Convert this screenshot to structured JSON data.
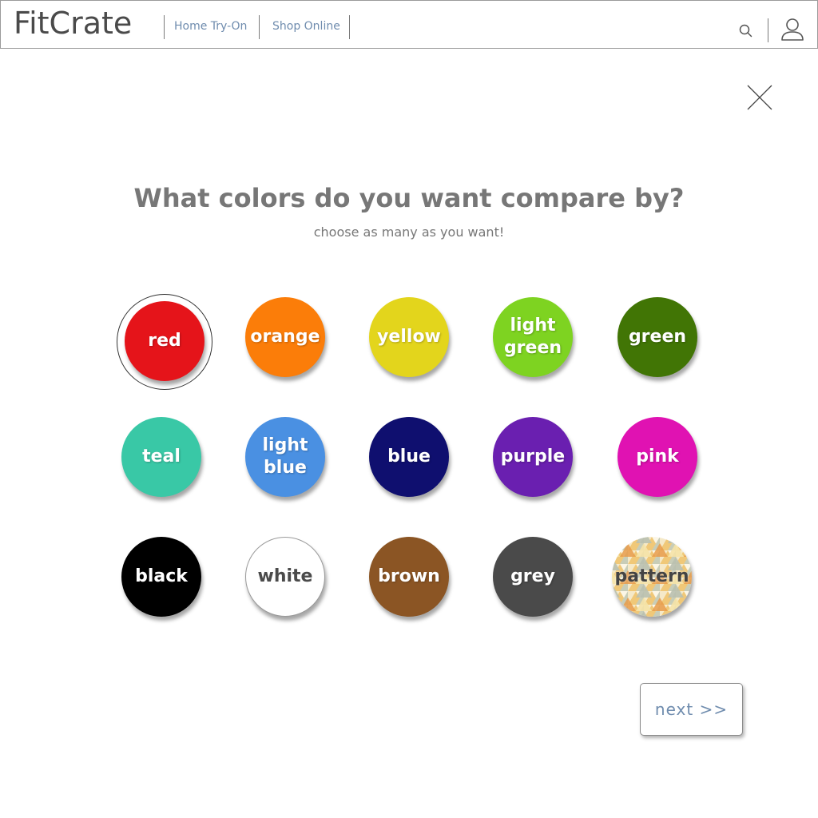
{
  "header": {
    "logo": "FitCrate",
    "nav": {
      "home_try_on": "Home Try-On",
      "shop_online": "Shop Online"
    },
    "icons": [
      "search-icon",
      "user-icon"
    ]
  },
  "close_icon": "close-icon",
  "question": {
    "title": "What colors do you want compare by?",
    "subtitle": "choose as many as you want!"
  },
  "colors": [
    {
      "label": "red",
      "hex": "#e5141a",
      "selected": true
    },
    {
      "label": "orange",
      "hex": "#fb7d09",
      "selected": false
    },
    {
      "label": "yellow",
      "hex": "#e3d51c",
      "selected": false
    },
    {
      "label": "light\ngreen",
      "hex": "#7ed321",
      "selected": false
    },
    {
      "label": "green",
      "hex": "#417505",
      "selected": false
    },
    {
      "label": "teal",
      "hex": "#39c8a6",
      "selected": false
    },
    {
      "label": "light\nblue",
      "hex": "#4a90e2",
      "selected": false
    },
    {
      "label": "blue",
      "hex": "#0f0f6f",
      "selected": false
    },
    {
      "label": "purple",
      "hex": "#6a1fb0",
      "selected": false
    },
    {
      "label": "pink",
      "hex": "#e012b2",
      "selected": false
    },
    {
      "label": "black",
      "hex": "#000000",
      "selected": false
    },
    {
      "label": "white",
      "hex": "#ffffff",
      "selected": false
    },
    {
      "label": "brown",
      "hex": "#8b5524",
      "selected": false
    },
    {
      "label": "grey",
      "hex": "#4a4a4a",
      "selected": false
    },
    {
      "label": "pattern",
      "hex": "pattern",
      "selected": false
    }
  ],
  "next_button": {
    "label": "next >>"
  }
}
